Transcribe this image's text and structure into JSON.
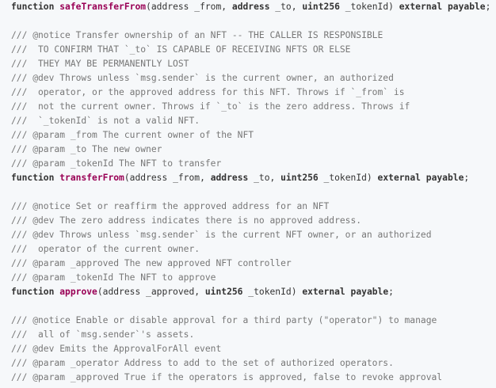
{
  "block1": {
    "sig": {
      "kw": "function",
      "name": "safeTransferFrom",
      "p1": "(address _from, ",
      "t2": "address",
      "p2": " _to, ",
      "t3": "uint256",
      "p3": " _tokenId) ",
      "mod1": "external",
      "mod2": "payable",
      "end": ";"
    }
  },
  "block2": {
    "comments": [
      "/// @notice Transfer ownership of an NFT -- THE CALLER IS RESPONSIBLE",
      "///  TO CONFIRM THAT `_to` IS CAPABLE OF RECEIVING NFTS OR ELSE",
      "///  THEY MAY BE PERMANENTLY LOST",
      "/// @dev Throws unless `msg.sender` is the current owner, an authorized",
      "///  operator, or the approved address for this NFT. Throws if `_from` is",
      "///  not the current owner. Throws if `_to` is the zero address. Throws if",
      "///  `_tokenId` is not a valid NFT.",
      "/// @param _from The current owner of the NFT",
      "/// @param _to The new owner",
      "/// @param _tokenId The NFT to transfer"
    ],
    "sig": {
      "kw": "function",
      "name": "transferFrom",
      "p1": "(address _from, ",
      "t2": "address",
      "p2": " _to, ",
      "t3": "uint256",
      "p3": " _tokenId) ",
      "mod1": "external",
      "mod2": "payable",
      "end": ";"
    }
  },
  "block3": {
    "comments": [
      "/// @notice Set or reaffirm the approved address for an NFT",
      "/// @dev The zero address indicates there is no approved address.",
      "/// @dev Throws unless `msg.sender` is the current NFT owner, or an authorized",
      "///  operator of the current owner.",
      "/// @param _approved The new approved NFT controller",
      "/// @param _tokenId The NFT to approve"
    ],
    "sig": {
      "kw": "function",
      "name": "approve",
      "p1": "(address _approved, ",
      "t3": "uint256",
      "p3": " _tokenId) ",
      "mod1": "external",
      "mod2": "payable",
      "end": ";"
    }
  },
  "block4": {
    "comments": [
      "/// @notice Enable or disable approval for a third party (\"operator\") to manage",
      "///  all of `msg.sender`'s assets.",
      "/// @dev Emits the ApprovalForAll event",
      "/// @param _operator Address to add to the set of authorized operators.",
      "/// @param _approved True if the operators is approved, false to revoke approval"
    ]
  }
}
